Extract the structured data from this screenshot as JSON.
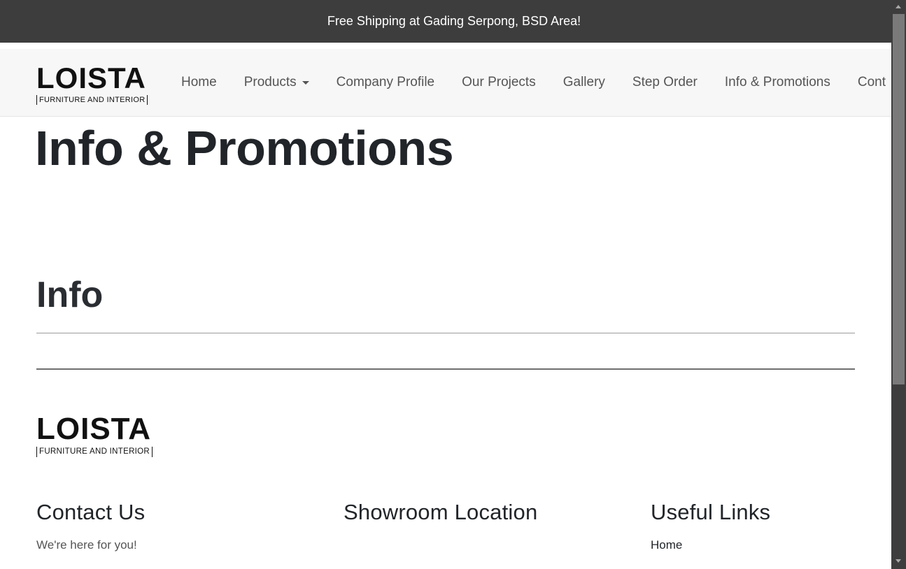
{
  "topbar": {
    "message": "Free Shipping at Gading Serpong, BSD Area!"
  },
  "brand": {
    "name": "LOISTA",
    "tagline": "FURNITURE AND INTERIOR"
  },
  "nav": {
    "home": "Home",
    "products": "Products",
    "company_profile": "Company Profile",
    "our_projects": "Our Projects",
    "gallery": "Gallery",
    "step_order": "Step Order",
    "info_promotions": "Info & Promotions",
    "contact": "Cont"
  },
  "main": {
    "title": "Info & Promotions",
    "section_heading": "Info"
  },
  "footer": {
    "contact": {
      "heading": "Contact Us",
      "text": "We're here for you!"
    },
    "showroom": {
      "heading": "Showroom Location"
    },
    "links": {
      "heading": "Useful Links",
      "items": [
        "Home"
      ]
    }
  }
}
